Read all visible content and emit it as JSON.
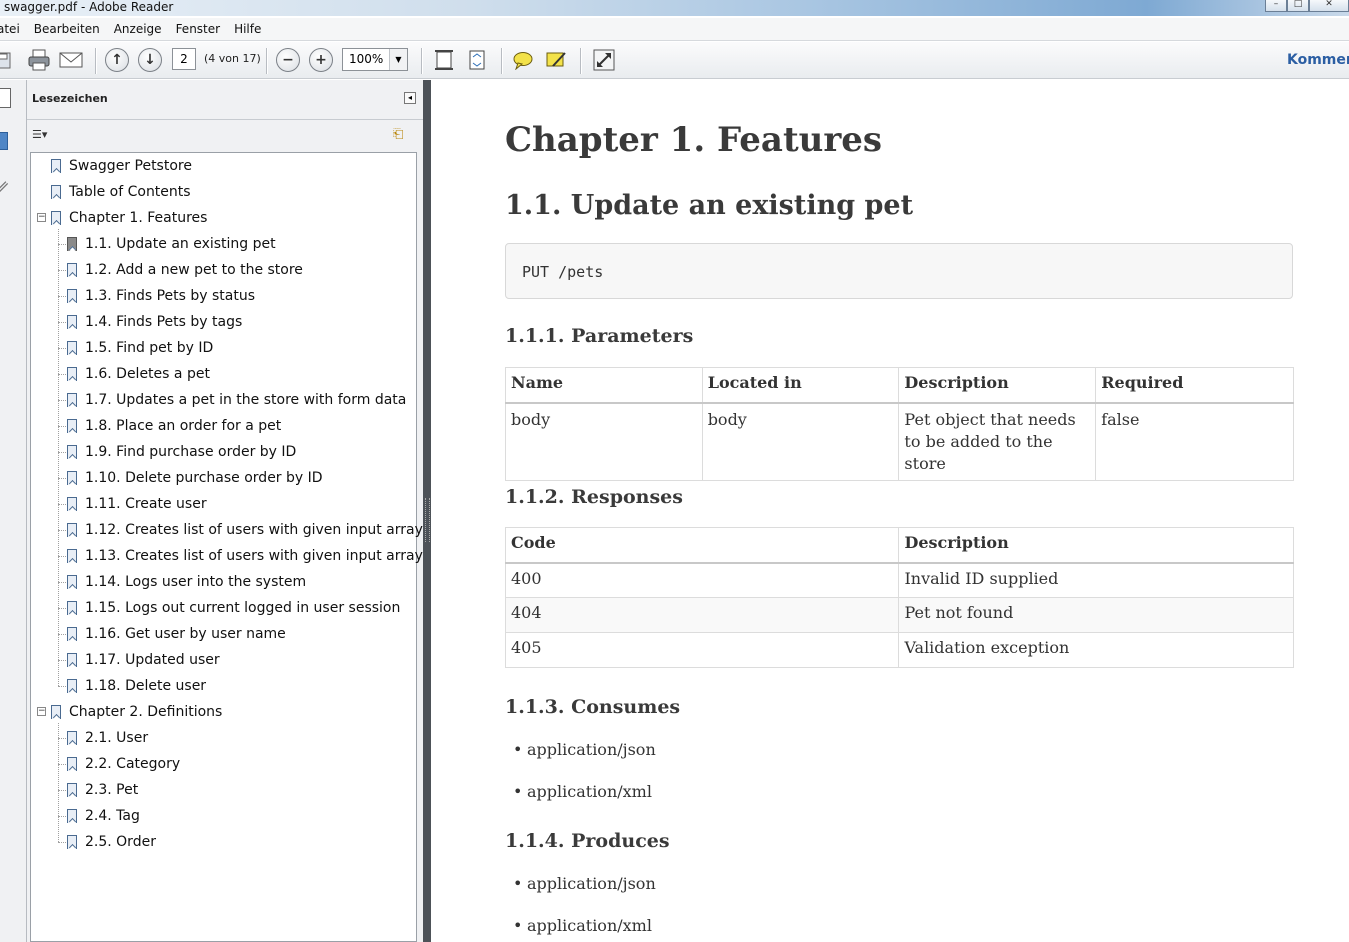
{
  "window": {
    "title": "swagger.pdf - Adobe Reader"
  },
  "menu": [
    "atei",
    "Bearbeiten",
    "Anzeige",
    "Fenster",
    "Hilfe"
  ],
  "toolbar": {
    "page_current": "2",
    "page_count": "(4 von 17)",
    "zoom": "100%",
    "comment_label": "Kommen"
  },
  "nav": {
    "header": "Lesezeichen",
    "bookmarks": [
      {
        "label": "Swagger Petstore",
        "level": 0
      },
      {
        "label": "Table of Contents",
        "level": 0
      },
      {
        "label": "Chapter 1. Features",
        "level": 0,
        "expanded": true
      },
      {
        "label": "1.1. Update an existing pet",
        "level": 1,
        "current": true
      },
      {
        "label": "1.2. Add a new pet to the store",
        "level": 1
      },
      {
        "label": "1.3. Finds Pets by status",
        "level": 1
      },
      {
        "label": "1.4. Finds Pets by tags",
        "level": 1
      },
      {
        "label": "1.5. Find pet by ID",
        "level": 1
      },
      {
        "label": "1.6. Deletes a pet",
        "level": 1
      },
      {
        "label": "1.7. Updates a pet in the store with form data",
        "level": 1
      },
      {
        "label": "1.8. Place an order for a pet",
        "level": 1
      },
      {
        "label": "1.9. Find purchase order by ID",
        "level": 1
      },
      {
        "label": "1.10. Delete purchase order by ID",
        "level": 1
      },
      {
        "label": "1.11. Create user",
        "level": 1
      },
      {
        "label": "1.12. Creates list of users with given input array",
        "level": 1
      },
      {
        "label": "1.13. Creates list of users with given input array",
        "level": 1
      },
      {
        "label": "1.14. Logs user into the system",
        "level": 1
      },
      {
        "label": "1.15. Logs out current logged in user session",
        "level": 1
      },
      {
        "label": "1.16. Get user by user name",
        "level": 1
      },
      {
        "label": "1.17. Updated user",
        "level": 1
      },
      {
        "label": "1.18. Delete user",
        "level": 1
      },
      {
        "label": "Chapter 2. Definitions",
        "level": 0,
        "expanded": true
      },
      {
        "label": "2.1. User",
        "level": 1
      },
      {
        "label": "2.2. Category",
        "level": 1
      },
      {
        "label": "2.3. Pet",
        "level": 1
      },
      {
        "label": "2.4. Tag",
        "level": 1
      },
      {
        "label": "2.5. Order",
        "level": 1
      }
    ]
  },
  "doc": {
    "chapter_title": "Chapter 1. Features",
    "section_title": "1.1. Update an existing pet",
    "endpoint": "PUT /pets",
    "parameters": {
      "title": "1.1.1. Parameters",
      "headers": [
        "Name",
        "Located in",
        "Description",
        "Required"
      ],
      "rows": [
        [
          "body",
          "body",
          "Pet object that needs to be added to the store",
          "false"
        ]
      ]
    },
    "responses": {
      "title": "1.1.2. Responses",
      "headers": [
        "Code",
        "Description"
      ],
      "rows": [
        [
          "400",
          "Invalid ID supplied"
        ],
        [
          "404",
          "Pet not found"
        ],
        [
          "405",
          "Validation exception"
        ]
      ]
    },
    "consumes": {
      "title": "1.1.3. Consumes",
      "items": [
        "application/json",
        "application/xml"
      ]
    },
    "produces": {
      "title": "1.1.4. Produces",
      "items": [
        "application/json",
        "application/xml"
      ]
    }
  }
}
